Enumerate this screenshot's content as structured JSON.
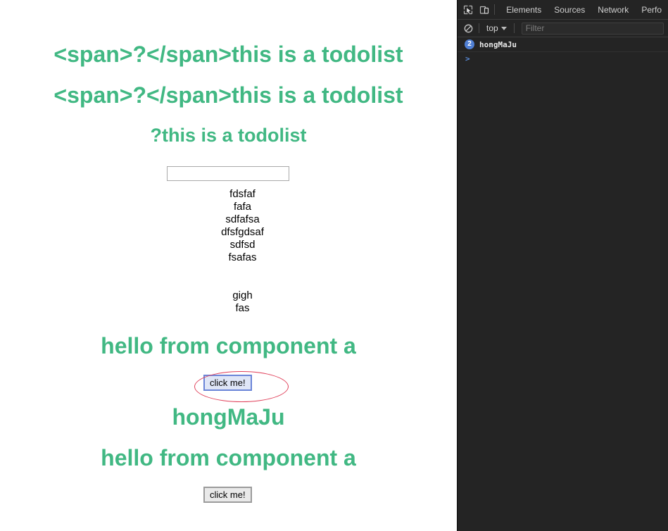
{
  "page": {
    "headings": [
      {
        "text": "<span>?</span>this is a todolist"
      },
      {
        "text": "<span>?</span>this is a todolist"
      },
      {
        "text": "?this is a todolist"
      }
    ],
    "todo_input": {
      "value": "",
      "placeholder": ""
    },
    "todo_items": [
      "fdsfaf",
      "fafa",
      "sdfafsa",
      "dfsfgdsaf",
      "sdfsd",
      "fsafas",
      "",
      "",
      "gigh",
      "fas"
    ],
    "component_a_heading_1": "hello from component a",
    "hongmaju_heading": "hongMaJu",
    "component_a_heading_2": "hello from component a",
    "buttons": {
      "click_me_1": "click me!",
      "click_me_2": "click me!"
    },
    "colors": {
      "heading_green": "#41b883",
      "annotation_red": "#e0405a",
      "focus_blue": "#6a84d8"
    }
  },
  "devtools": {
    "icons": {
      "inspect": "inspect-element-icon",
      "device": "device-toolbar-icon",
      "clear_console": "clear-console-icon"
    },
    "tabs": [
      {
        "label": "Elements"
      },
      {
        "label": "Sources"
      },
      {
        "label": "Network"
      },
      {
        "label": "Perfo"
      }
    ],
    "filter_bar": {
      "context": "top",
      "filter_placeholder": "Filter",
      "filter_value": ""
    },
    "console": {
      "messages": [
        {
          "count": "2",
          "text": "hongMaJu"
        }
      ],
      "prompt": ">"
    },
    "colors": {
      "panel_bg": "#242424",
      "badge_blue": "#4f7fd4"
    }
  }
}
